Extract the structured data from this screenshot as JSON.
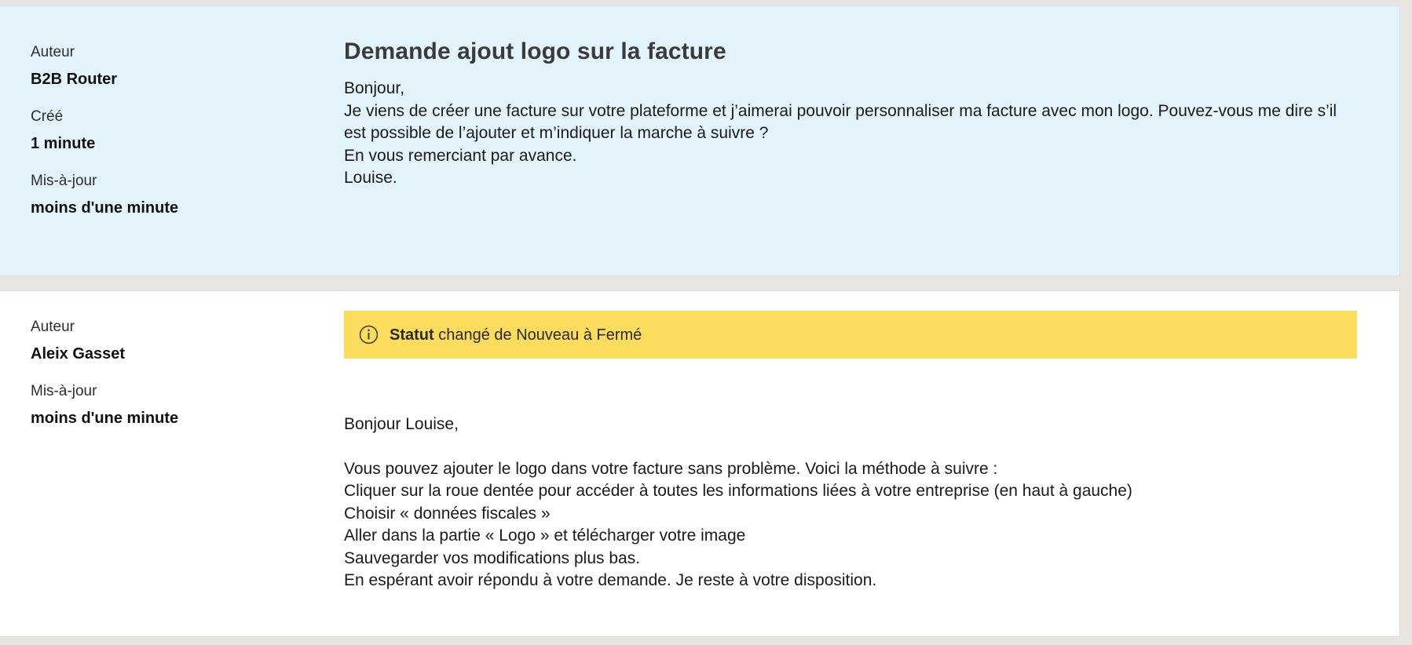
{
  "theme": {
    "page_background": "#e8e4e1",
    "first_card_background": "#e2f3fc",
    "second_card_background": "#ffffff",
    "status_banner_background": "#fcdc5c",
    "title_color": "#3b3b3b",
    "text_color": "#1a1a1a"
  },
  "messages": [
    {
      "meta": {
        "author_label": "Auteur",
        "author_value": "B2B Router",
        "created_label": "Créé",
        "created_value": "1 minute",
        "updated_label": "Mis-à-jour",
        "updated_value": "moins d'une minute"
      },
      "title": "Demande ajout logo sur la facture",
      "body_lines": [
        "Bonjour,",
        "Je viens de créer une facture sur votre plateforme et j’aimerai pouvoir personnaliser ma facture avec mon logo. Pouvez-vous me dire s’il est possible de l’ajouter et m’indiquer la marche à suivre ?",
        "En vous remerciant par avance.",
        "Louise."
      ]
    },
    {
      "meta": {
        "author_label": "Auteur",
        "author_value": "Aleix Gasset",
        "updated_label": "Mis-à-jour",
        "updated_value": "moins d'une minute"
      },
      "status_banner": {
        "icon": "info-circle-icon",
        "strong_text": "Statut",
        "rest_text": " changé de Nouveau à Fermé"
      },
      "body_lines": [
        "Bonjour Louise,",
        "Vous pouvez ajouter le logo dans votre facture sans problème. Voici la méthode à suivre :",
        "Cliquer sur la roue dentée pour accéder à toutes les informations liées à votre entreprise (en haut à gauche)",
        "Choisir « données fiscales »",
        "Aller dans la partie « Logo » et télécharger votre image",
        "Sauvegarder vos modifications plus bas.",
        "En espérant avoir répondu à votre demande. Je reste à votre disposition."
      ]
    }
  ]
}
